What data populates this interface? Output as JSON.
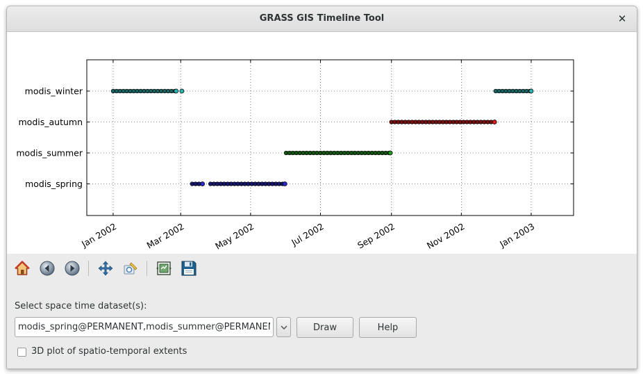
{
  "window": {
    "title": "GRASS GIS Timeline Tool",
    "close_glyph": "✕"
  },
  "toolbar": {
    "icons": [
      "home-icon",
      "back-icon",
      "forward-icon",
      "pan-icon",
      "zoom-icon",
      "configure-subplots-icon",
      "save-icon"
    ]
  },
  "form": {
    "select_label": "Select space time dataset(s):",
    "dataset_value": "modis_spring@PERMANENT,modis_summer@PERMANENT",
    "draw_label": "Draw",
    "help_label": "Help",
    "checkbox_label": "3D plot of spatio-temporal extents",
    "checkbox_checked": false
  },
  "chart_data": {
    "type": "scatter",
    "x_axis": {
      "kind": "date",
      "range": [
        "2001-12-09",
        "2003-02-07"
      ],
      "ticks": [
        {
          "date": "2002-01-01",
          "label": "Jan 2002"
        },
        {
          "date": "2002-03-01",
          "label": "Mar 2002"
        },
        {
          "date": "2002-05-01",
          "label": "May 2002"
        },
        {
          "date": "2002-07-01",
          "label": "Jul 2002"
        },
        {
          "date": "2002-09-01",
          "label": "Sep 2002"
        },
        {
          "date": "2002-11-01",
          "label": "Nov 2002"
        },
        {
          "date": "2003-01-01",
          "label": "Jan 2003"
        }
      ]
    },
    "grid": true,
    "series": [
      {
        "name": "modis_winter",
        "color": "#2ab5b0",
        "intervals": [
          [
            "2002-01-01",
            "2002-02-25"
          ],
          [
            "2002-12-01",
            "2003-01-01"
          ]
        ],
        "points": [
          "2002-03-02"
        ]
      },
      {
        "name": "modis_autumn",
        "color": "#d81b1b",
        "intervals": [
          [
            "2002-09-01",
            "2002-11-30"
          ]
        ],
        "points": []
      },
      {
        "name": "modis_summer",
        "color": "#1f9a1f",
        "intervals": [
          [
            "2002-06-01",
            "2002-08-31"
          ]
        ],
        "points": []
      },
      {
        "name": "modis_spring",
        "color": "#2a2ac8",
        "intervals": [
          [
            "2002-03-11",
            "2002-03-20"
          ],
          [
            "2002-03-27",
            "2002-05-31"
          ]
        ],
        "points": []
      }
    ]
  }
}
